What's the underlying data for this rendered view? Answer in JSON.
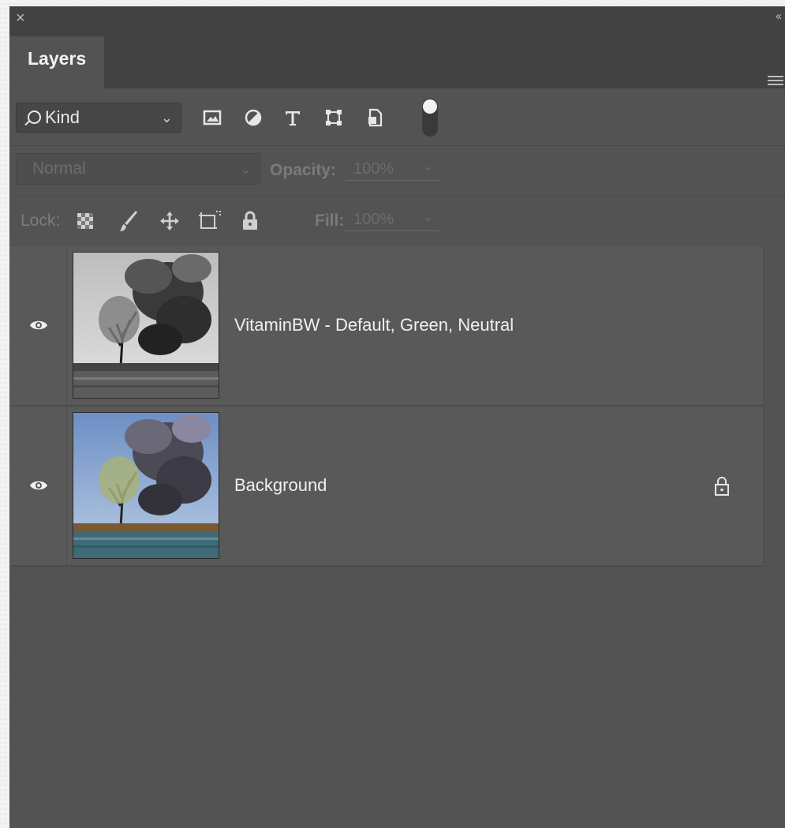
{
  "panel": {
    "close_glyph": "×",
    "collapse_glyph": "‹‹",
    "tab_label": "Layers",
    "menu_icon": "hamburger-menu-icon"
  },
  "filter": {
    "kind_label": "Kind",
    "kind_chevron": "⌄",
    "icons": [
      "pixel-layer-filter-icon",
      "adjustment-layer-filter-icon",
      "type-layer-filter-icon",
      "shape-layer-filter-icon",
      "smart-object-filter-icon",
      "filter-toggle-icon"
    ]
  },
  "blend": {
    "mode": "Normal",
    "opacity_label": "Opacity:",
    "opacity_value": "100%"
  },
  "lock": {
    "label": "Lock:",
    "fill_label": "Fill:",
    "fill_value": "100%",
    "icons": [
      "lock-transparent-pixels-icon",
      "lock-image-pixels-icon",
      "lock-position-icon",
      "lock-artboard-icon",
      "lock-all-icon"
    ]
  },
  "layers": [
    {
      "name": "VitaminBW - Default, Green, Neutral",
      "visible": true,
      "locked": false,
      "thumbnail": "black-and-white smoke over tree landscape"
    },
    {
      "name": "Background",
      "visible": true,
      "locked": true,
      "thumbnail": "color smoke over tree landscape"
    }
  ],
  "colors": {
    "panel_bg": "#535353",
    "header_bg": "#424242",
    "row_bg": "#595959",
    "text": "#f0f0f0",
    "dim_text": "#6d6d6d"
  }
}
